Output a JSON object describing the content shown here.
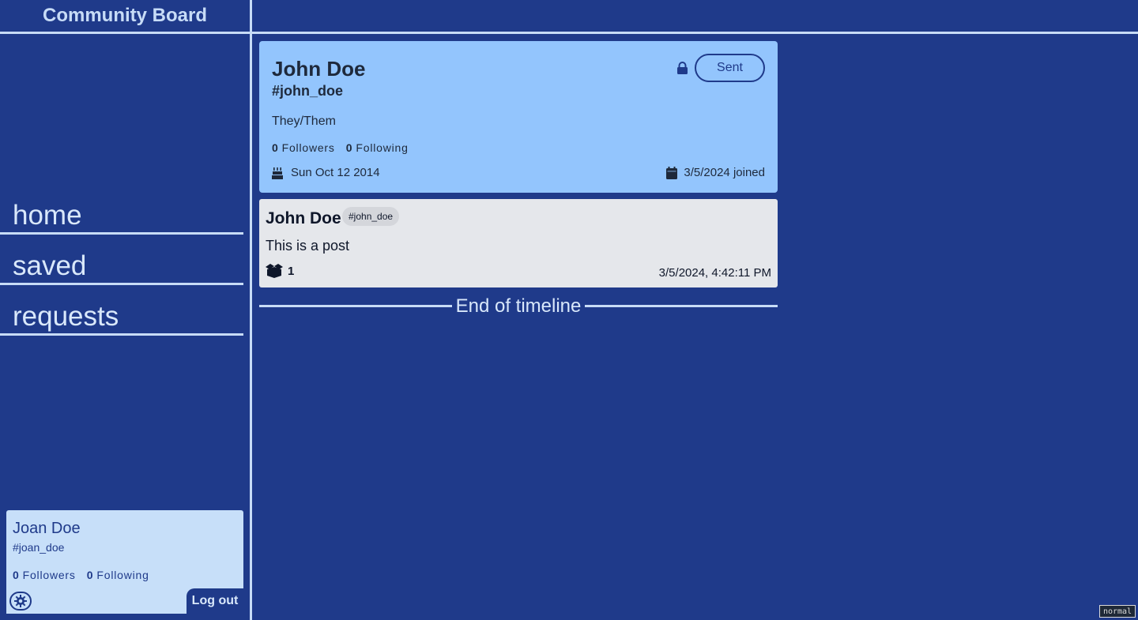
{
  "app": {
    "title": "Community Board"
  },
  "nav": {
    "items": [
      {
        "label": "home"
      },
      {
        "label": "saved"
      },
      {
        "label": "requests"
      }
    ]
  },
  "current_user": {
    "name": "Joan Doe",
    "handle": "#joan_doe",
    "followers_count": "0",
    "followers_label": "Followers",
    "following_count": "0",
    "following_label": "Following",
    "logout_label": "Log out",
    "settings_icon": "gear-icon"
  },
  "profile": {
    "name": "John Doe",
    "handle": "#john_doe",
    "pronouns": "They/Them",
    "followers_count": "0",
    "followers_label": "Followers",
    "following_count": "0",
    "following_label": "Following",
    "birthday": "Sun Oct 12 2014",
    "joined_date": "3/5/2024",
    "joined_label": "joined",
    "request_button_label": "Sent",
    "private": true
  },
  "timeline": {
    "posts": [
      {
        "author": "John Doe",
        "handle": "#john_doe",
        "body": "This is a post",
        "reaction_count": "1",
        "timestamp": "3/5/2024, 4:42:11 PM"
      }
    ],
    "end_label": "End of timeline"
  },
  "mode_badge": "normal",
  "colors": {
    "background": "#1f3a8a",
    "accent_light": "#c7dcf7",
    "profile_card": "#93c5fd",
    "post_card": "#e5e7eb"
  }
}
